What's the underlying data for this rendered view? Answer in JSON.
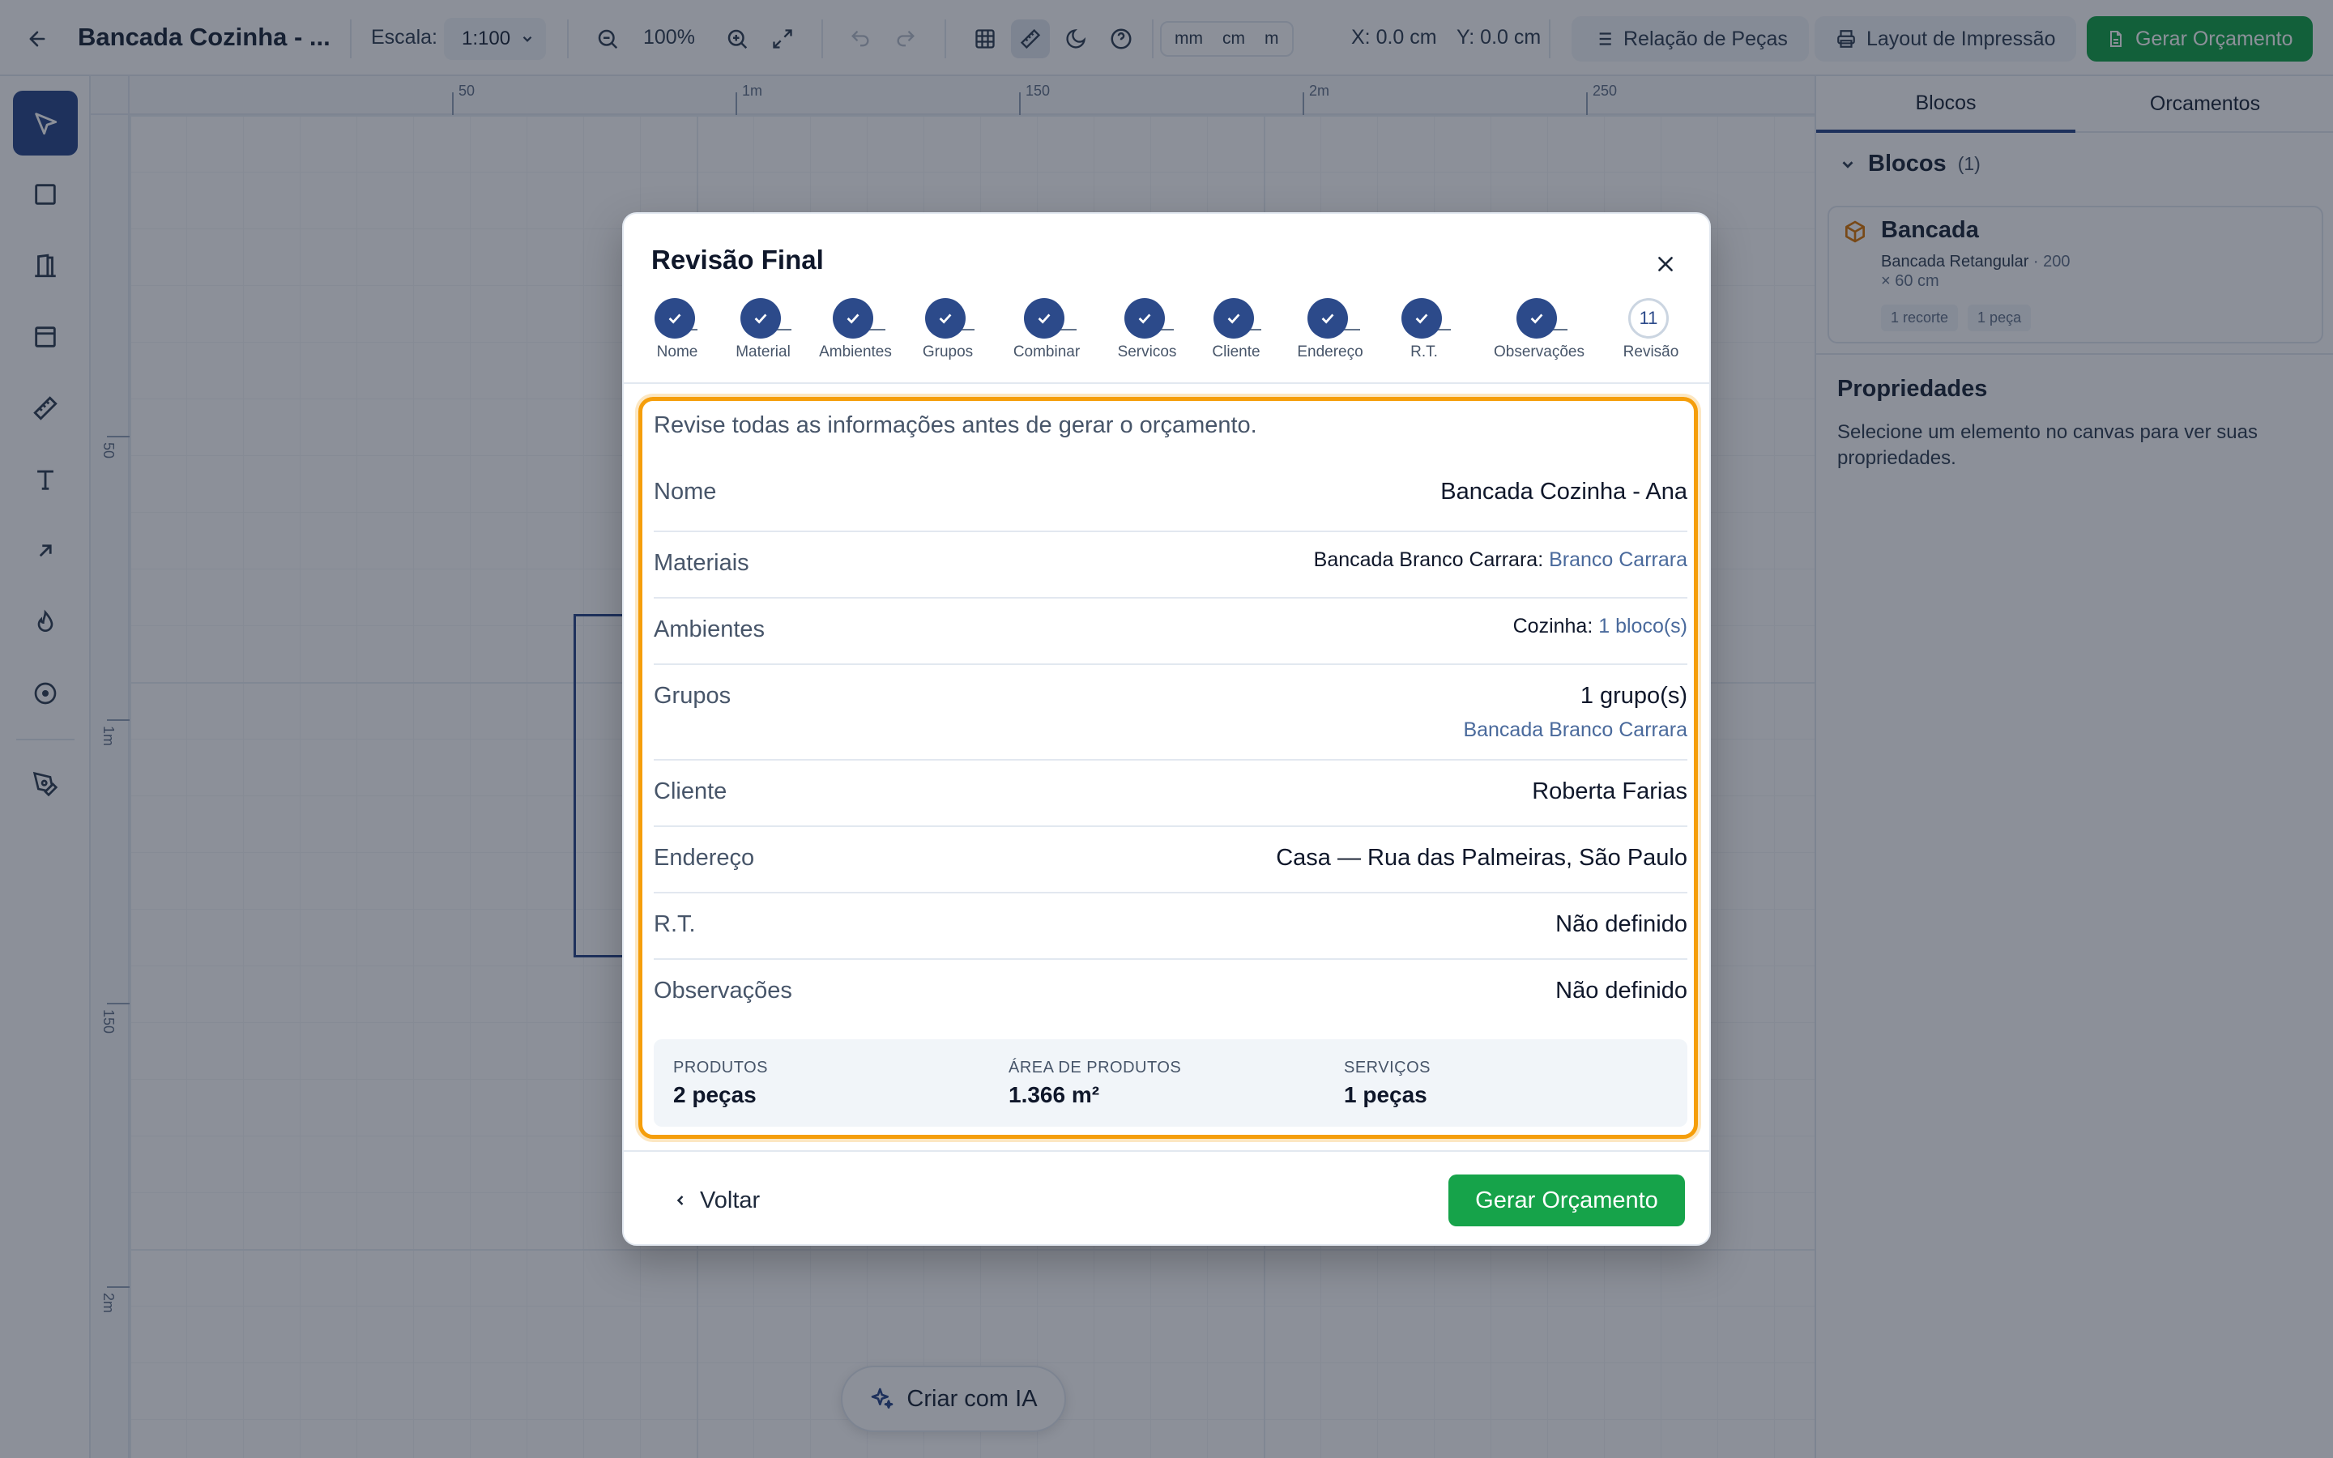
{
  "toolbar": {
    "project_title": "Bancada Cozinha - ...",
    "scale_label": "Escala:",
    "scale_value": "1:100",
    "zoom": "100%",
    "units": [
      "mm",
      "cm",
      "m"
    ],
    "x_coord": "X: 0.0 cm",
    "y_coord": "Y: 0.0 cm",
    "parts_list": "Relação de Peças",
    "print_layout": "Layout de Impressão",
    "generate_quote": "Gerar Orçamento"
  },
  "ruler": {
    "top": [
      "50",
      "1m",
      "150",
      "2m",
      "250"
    ],
    "left": [
      "50",
      "1m",
      "150",
      "2m"
    ]
  },
  "canvas": {
    "ai_button": "Criar com IA"
  },
  "panel": {
    "tabs": [
      "Blocos",
      "Orcamentos"
    ],
    "blocks_heading": "Blocos",
    "blocks_count": "(1)",
    "block": {
      "name": "Bancada",
      "type": "Bancada Retangular",
      "dims_a": "· 200",
      "dims_b": "× 60 cm",
      "chips": [
        "1 recorte",
        "1 peça"
      ]
    },
    "properties_heading": "Propriedades",
    "properties_hint": "Selecione um elemento no canvas para ver suas propriedades."
  },
  "modal": {
    "title": "Revisão Final",
    "steps": [
      "Nome",
      "Material",
      "Ambientes",
      "Grupos",
      "Combinar",
      "Servicos",
      "Cliente",
      "Endereço",
      "R.T.",
      "Observações",
      "Revisão"
    ],
    "current_step_number": "11",
    "intro": "Revise todas as informações antes de gerar o orçamento.",
    "rows": {
      "nome": {
        "label": "Nome",
        "value": "Bancada Cozinha - Ana"
      },
      "materiais": {
        "label": "Materiais",
        "key": "Bancada Branco Carrara:",
        "value": "Branco Carrara"
      },
      "ambientes": {
        "label": "Ambientes",
        "key": "Cozinha:",
        "value": "1 bloco(s)"
      },
      "grupos": {
        "label": "Grupos",
        "value": "1 grupo(s)",
        "sub": "Bancada Branco Carrara"
      },
      "cliente": {
        "label": "Cliente",
        "value": "Roberta Farias"
      },
      "endereco": {
        "label": "Endereço",
        "value": "Casa — Rua das Palmeiras, São Paulo"
      },
      "rt": {
        "label": "R.T.",
        "value": "Não definido"
      },
      "observacoes": {
        "label": "Observações",
        "value": "Não definido"
      }
    },
    "summary": [
      {
        "label": "PRODUTOS",
        "value": "2 peças"
      },
      {
        "label": "ÁREA DE PRODUTOS",
        "value": "1.366 m²"
      },
      {
        "label": "SERVIÇOS",
        "value": "1 peças"
      }
    ],
    "back": "Voltar",
    "generate": "Gerar Orçamento"
  },
  "colors": {
    "primary_blue": "#2c4a8a",
    "accent_green": "#16a34a",
    "highlight_orange": "#f59e0b"
  }
}
